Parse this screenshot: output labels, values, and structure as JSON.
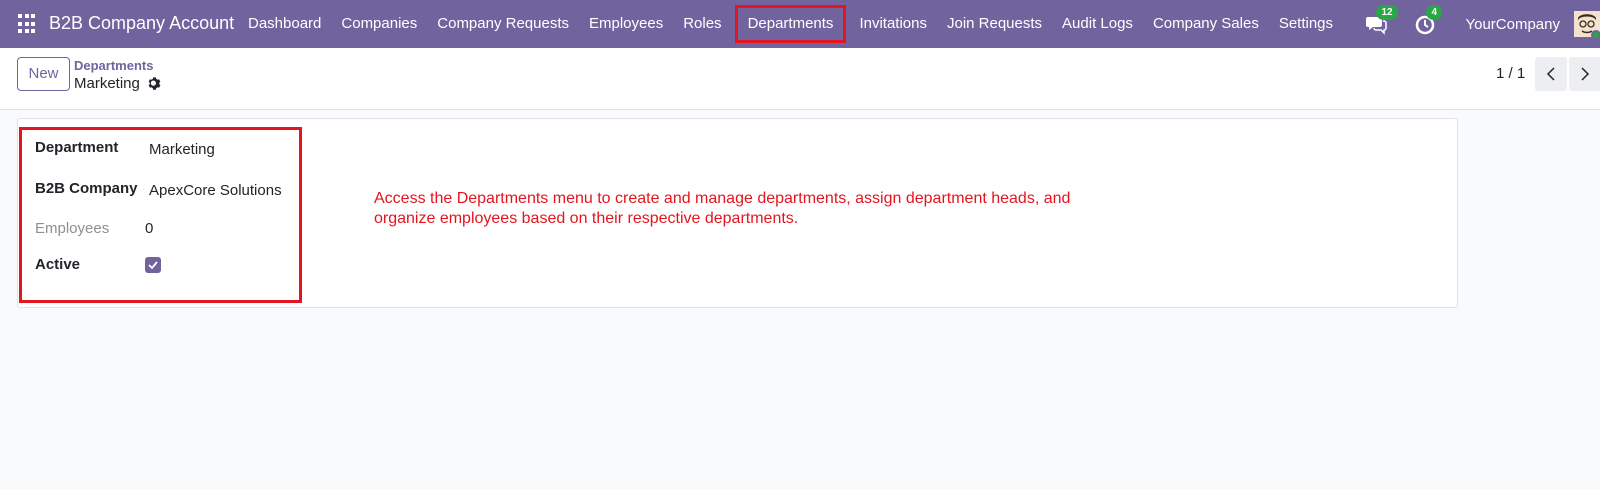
{
  "navbar": {
    "app_title": "B2B Company Account",
    "menu": [
      {
        "label": "Dashboard"
      },
      {
        "label": "Companies"
      },
      {
        "label": "Company Requests"
      },
      {
        "label": "Employees"
      },
      {
        "label": "Roles"
      },
      {
        "label": "Departments"
      },
      {
        "label": "Invitations"
      },
      {
        "label": "Join Requests"
      },
      {
        "label": "Audit Logs"
      },
      {
        "label": "Company Sales"
      },
      {
        "label": "Settings"
      }
    ],
    "messages_count": "12",
    "activities_count": "4",
    "company": "YourCompany"
  },
  "control_panel": {
    "new_label": "New",
    "breadcrumb_parent": "Departments",
    "breadcrumb_current": "Marketing",
    "pager": "1 / 1"
  },
  "form": {
    "department_label": "Department",
    "department_value": "Marketing",
    "company_label": "B2B Company",
    "company_value": "ApexCore Solutions",
    "employees_label": "Employees",
    "employees_value": "0",
    "active_label": "Active",
    "active_checked": true
  },
  "annotation": "Access the Departments menu to create and manage departments, assign department heads, and organize employees based on their respective departments.",
  "colors": {
    "brand": "#71639e",
    "highlight": "#e4151f",
    "badge": "#28a745"
  }
}
